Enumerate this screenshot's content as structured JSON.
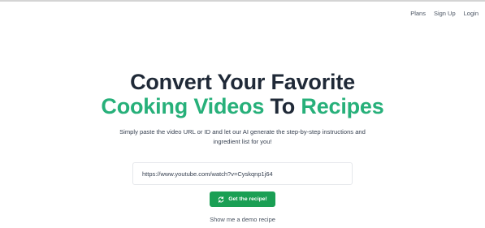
{
  "nav": {
    "items": [
      {
        "label": "Plans"
      },
      {
        "label": "Sign Up"
      },
      {
        "label": "Login"
      }
    ]
  },
  "hero": {
    "headline_line1": "Convert Your Favorite",
    "headline_line2": {
      "part1": "Cooking",
      "part2": "Videos",
      "part3": "To",
      "part4": "Recipes"
    },
    "subtitle": "Simply paste the video URL or ID and let our AI generate the step-by-step instructions and ingredient list for you!"
  },
  "form": {
    "url_value": "https://www.youtube.com/watch?v=Cyskqnp1j64",
    "submit_label": "Get the recipe!",
    "submit_icon": "refresh-icon",
    "demo_label": "Show me a demo recipe"
  },
  "colors": {
    "accent": "#27b07a",
    "button": "#1a9f54",
    "heading": "#1f2937"
  }
}
